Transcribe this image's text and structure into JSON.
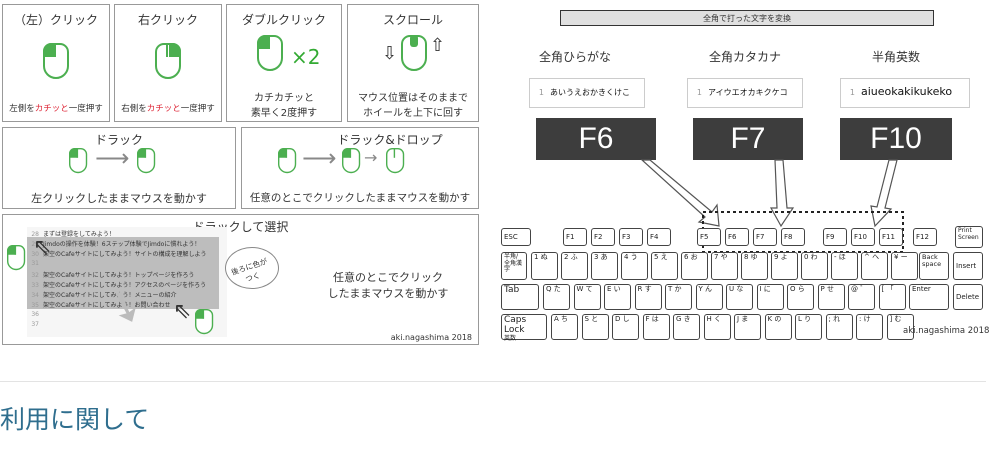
{
  "left": {
    "row1": [
      {
        "title": "（左）クリック",
        "caption_pre": "左側を",
        "caption_hl": "カチッと",
        "caption_post": "一度押す"
      },
      {
        "title": "右クリック",
        "caption_pre": "右側を",
        "caption_hl": "カチッと",
        "caption_post": "一度押す"
      },
      {
        "title": "ダブルクリック",
        "caption_line1": "カチカチッと",
        "caption_line2": "素早く2度押す",
        "times": "×2"
      },
      {
        "title": "スクロール",
        "caption_line1": "マウス位置はそのままで",
        "caption_line2": "ホイールを上下に回す"
      }
    ],
    "row2": [
      {
        "title": "ドラック",
        "caption": "左クリックしたままマウスを動かす"
      },
      {
        "title": "ドラック&ドロップ",
        "caption": "任意のとこでクリックしたままマウスを動かす"
      }
    ],
    "row3": {
      "title": "ドラックして選択",
      "list": [
        "まずは登録をしてみよう！",
        "Jimdoの操作を体験！6ステップ体験でJimdoに慣れよう！",
        "架空のCafeサイトにしてみよう！サイトの構成を理解しよう",
        "",
        "架空のCafeサイトにしてみよう！トップページを作ろう",
        "架空のCafeサイトにしてみよう！アクセスのページを作ろう",
        "架空のCafeサイトにしてみよう！メニューの紹介",
        "架空のCafeサイトにしてみよう！お問い合わせ",
        "",
        ""
      ],
      "line_numbers": [
        "28",
        "29",
        "30",
        "31",
        "32",
        "33",
        "34",
        "35",
        "36",
        "37"
      ],
      "bubble": "後ろに色がつく",
      "caption_line1": "任意のとこでクリック",
      "caption_line2": "したままマウスを動かす",
      "credit": "aki.nagashima 2018"
    }
  },
  "right": {
    "banner": "全角で打った文字を変換",
    "columns": [
      {
        "heading": "全角ひらがな",
        "line": "1",
        "text": "あいうえおかきくけこ",
        "key": "F6"
      },
      {
        "heading": "全角カタカナ",
        "line": "1",
        "text": "アイウエオカキクケコ",
        "key": "F7"
      },
      {
        "heading": "半角英数",
        "line": "1",
        "text": "aiueokakikukeko",
        "key": "F10"
      }
    ],
    "keys": {
      "esc": "ESC",
      "f": [
        "F1",
        "F2",
        "F3",
        "F4",
        "F5",
        "F6",
        "F7",
        "F8",
        "F9",
        "F10",
        "F11",
        "F12"
      ],
      "print": "Print Screen",
      "hankaku": "半角/全角漢字",
      "back": "Back space",
      "insert": "Insert",
      "tab": "Tab",
      "enter": "Enter",
      "delete": "Delete",
      "caps": "Caps Lock",
      "caps_sub": "英数",
      "num_row": [
        "1 ぬ",
        "2 ふ",
        "3 あ",
        "4 う",
        "5 え",
        "6 お",
        "7 や",
        "8 ゆ",
        "9 よ",
        "0 わ",
        "- ほ",
        "^ へ",
        "¥ ー"
      ],
      "q_row": [
        "Q た",
        "W て",
        "E い",
        "R す",
        "T か",
        "Y ん",
        "U な",
        "I に",
        "O ら",
        "P せ",
        "@ ゛",
        "[ 「"
      ],
      "a_row": [
        "A ち",
        "S と",
        "D し",
        "F は",
        "G き",
        "H く",
        "J ま",
        "K の",
        "L り",
        "; れ",
        ": け",
        "] む"
      ]
    },
    "credit": "aki.nagashima 2018"
  },
  "section_title": "利用に関して",
  "colors": {
    "accent": "#4caf50",
    "link_title": "#2f6e8e",
    "key_bg": "#3d3d3d",
    "highlight": "#d23"
  }
}
